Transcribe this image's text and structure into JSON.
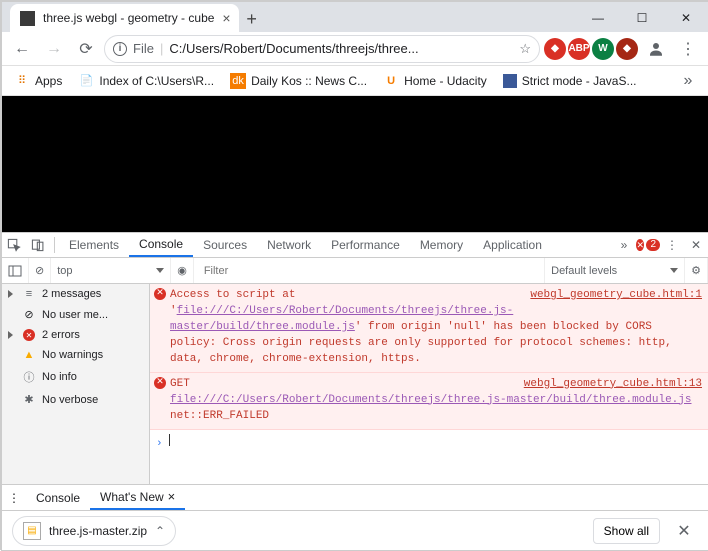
{
  "window": {
    "tab_title": "three.js webgl - geometry - cube",
    "newtab": "+"
  },
  "address": {
    "scheme_label": "File",
    "url": "C:/Users/Robert/Documents/threejs/three..."
  },
  "extensions": {
    "e1": "●",
    "e2": "ABP",
    "e3": "W",
    "e4": "●"
  },
  "bookmarks": {
    "apps": "Apps",
    "b1": "Index of C:\\Users\\R...",
    "b2": "Daily Kos :: News C...",
    "b3": "Home - Udacity",
    "b4": "Strict mode - JavaS..."
  },
  "devtools": {
    "tabs": {
      "elements": "Elements",
      "console": "Console",
      "sources": "Sources",
      "network": "Network",
      "performance": "Performance",
      "memory": "Memory",
      "application": "Application"
    },
    "error_count": "2",
    "filter": {
      "context": "top",
      "placeholder": "Filter",
      "levels": "Default levels"
    },
    "side": {
      "messages": "2 messages",
      "nouser": "No user me...",
      "errors": "2 errors",
      "nowarn": "No warnings",
      "noinfo": "No info",
      "noverbose": "No verbose"
    },
    "msg1": {
      "pre": "Access to script at '",
      "link1": "file:///C:/Users/Robert/Documents/threejs/three.js-master/build/three.module.js",
      "post": "' from origin 'null' has been blocked by CORS policy: Cross origin requests are only supported for protocol schemes: http, data, chrome, chrome-extension, https.",
      "src": "webgl_geometry_cube.html:1"
    },
    "msg2": {
      "pre": "GET ",
      "link1": "file:///C:/Users/Robert/Documents/threejs/three.js-master/build/three.module.js",
      "post": " net::ERR_FAILED",
      "src": "webgl_geometry_cube.html:13"
    },
    "prompt": "›"
  },
  "drawer": {
    "console": "Console",
    "whatsnew": "What's New"
  },
  "download": {
    "file": "three.js-master.zip",
    "showall": "Show all"
  }
}
